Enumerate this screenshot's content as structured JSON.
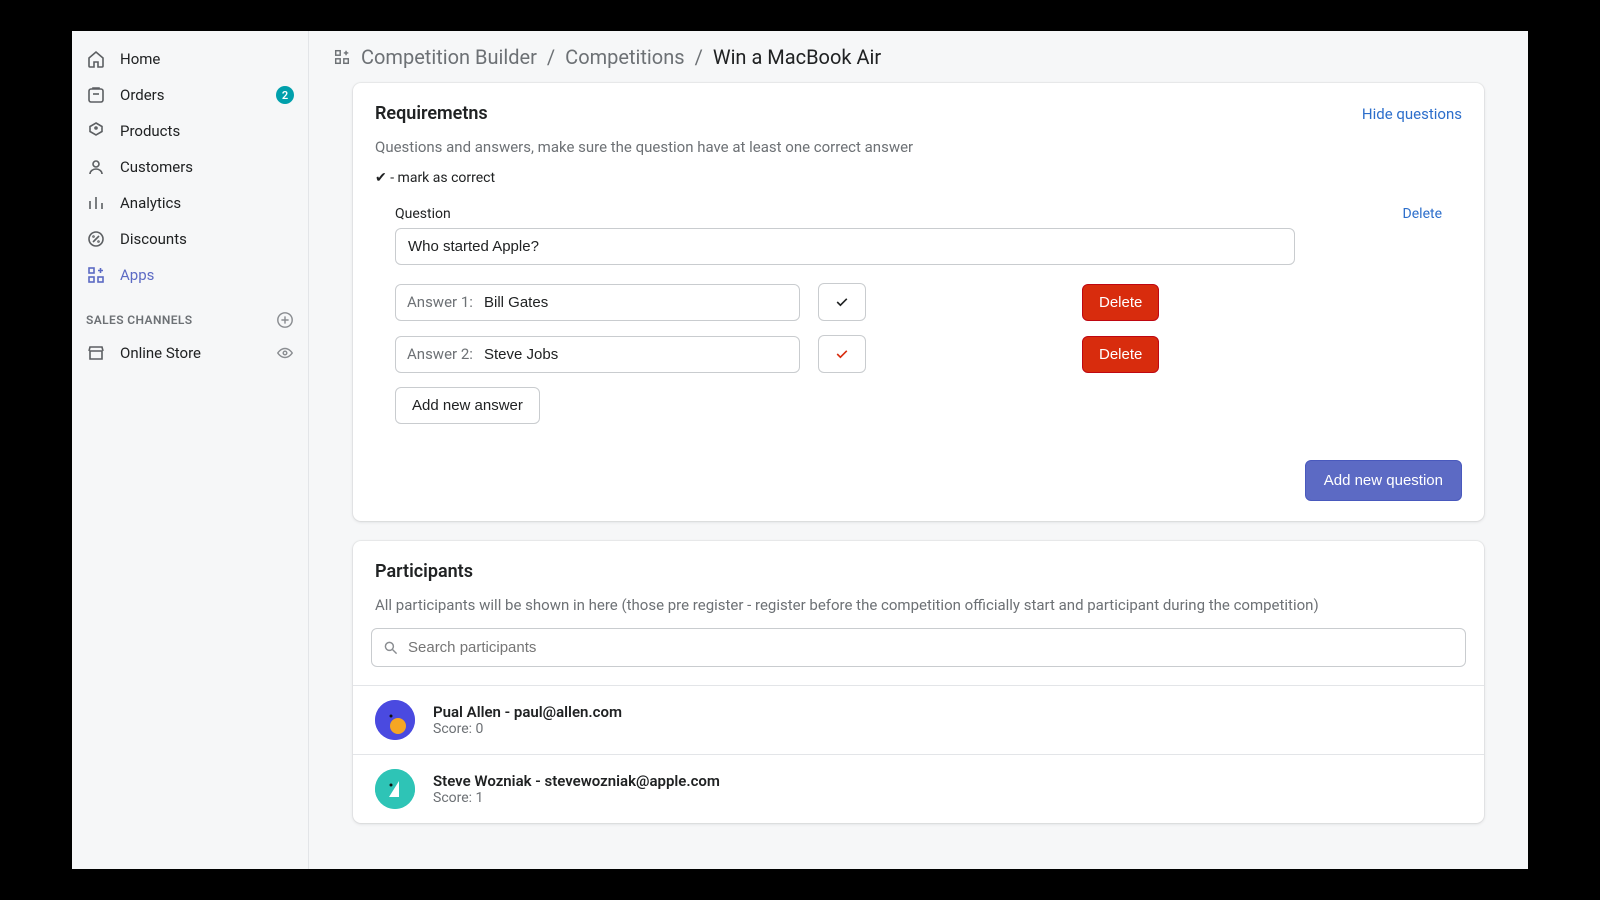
{
  "sidebar": {
    "items": [
      {
        "label": "Home",
        "icon": "home"
      },
      {
        "label": "Orders",
        "icon": "orders",
        "badge": "2"
      },
      {
        "label": "Products",
        "icon": "products"
      },
      {
        "label": "Customers",
        "icon": "customers"
      },
      {
        "label": "Analytics",
        "icon": "analytics"
      },
      {
        "label": "Discounts",
        "icon": "discounts"
      },
      {
        "label": "Apps",
        "icon": "apps",
        "active": true
      }
    ],
    "section_label": "SALES CHANNELS",
    "channels": [
      {
        "label": "Online Store"
      }
    ]
  },
  "breadcrumb": {
    "parts": [
      "Competition Builder",
      "Competitions",
      "Win a MacBook Air"
    ]
  },
  "requirements": {
    "title": "Requiremetns",
    "hide_label": "Hide questions",
    "help": "Questions and answers, make sure the question have at least one correct answer",
    "mark_hint": "✔ - mark as correct",
    "question_label": "Question",
    "delete_label": "Delete",
    "question_value": "Who started Apple?",
    "answers": [
      {
        "prefix": "Answer 1:",
        "value": "Bill Gates",
        "correct": false,
        "delete_label": "Delete"
      },
      {
        "prefix": "Answer 2:",
        "value": "Steve Jobs",
        "correct": true,
        "delete_label": "Delete"
      }
    ],
    "add_answer_label": "Add new answer",
    "add_question_label": "Add new question"
  },
  "participants": {
    "title": "Participants",
    "help": "All participants will be shown in here (those pre register - register before the competition officially start and participant during the competition)",
    "search_placeholder": "Search participants",
    "list": [
      {
        "name_line": "Pual Allen - paul@allen.com",
        "score_line": "Score: 0"
      },
      {
        "name_line": "Steve Wozniak - stevewozniak@apple.com",
        "score_line": "Score: 1"
      }
    ]
  }
}
